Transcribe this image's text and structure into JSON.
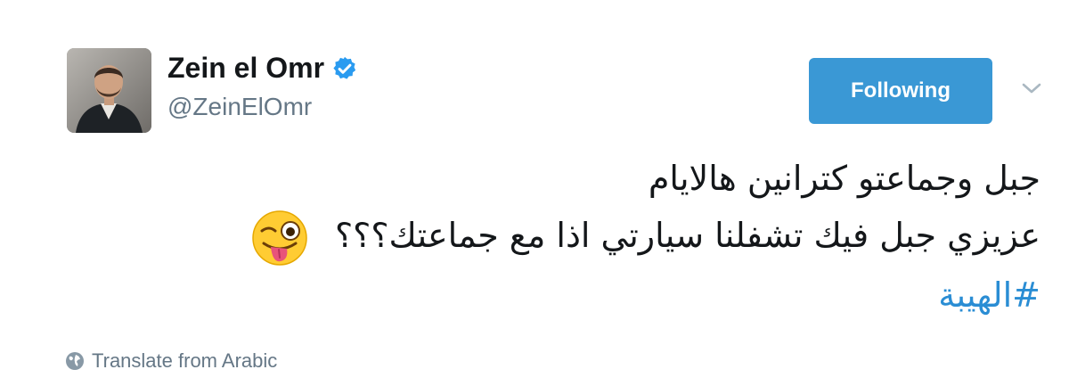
{
  "author": {
    "display_name": "Zein el Omr",
    "handle": "@ZeinElOmr",
    "verified": true,
    "avatar_icon": "profile-photo"
  },
  "follow_button": {
    "label": "Following",
    "color": "#3a98d5"
  },
  "menu": {
    "icon": "chevron-down-icon"
  },
  "tweet": {
    "line1": "جبل وجماعتو كترانين هالايام",
    "line2": "عزيزي جبل فيك تشفلنا سيارتي اذا مع جماعتك؟؟؟",
    "emoji": "winking-face-with-tongue-icon",
    "hashtag": "#الهيبة"
  },
  "translate": {
    "label": "Translate from Arabic",
    "icon": "globe-icon"
  },
  "colors": {
    "link": "#2a8dd4",
    "secondary_text": "#657786",
    "primary_text": "#14171a"
  }
}
